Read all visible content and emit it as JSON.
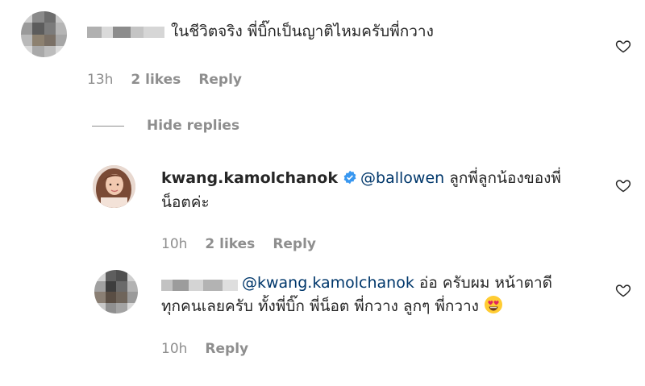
{
  "comments": [
    {
      "text": "ในชีวิตจริง พี่บิ๊กเป็นญาติไหมครับพี่กวาง",
      "time": "13h",
      "likes": "2 likes",
      "reply_label": "Reply"
    }
  ],
  "hide_replies_label": "Hide replies",
  "replies": [
    {
      "username": "kwang.kamolchanok",
      "mention": "@ballowen",
      "text_line1": "ลูกพี่ลูกน้องของพี่",
      "text_line2": "น็อตค่ะ",
      "time": "10h",
      "likes": "2 likes",
      "reply_label": "Reply"
    },
    {
      "mention": "@kwang.kamolchanok",
      "text_line1": "อ่อ ครับผม หน้าตาดี",
      "text_line2": "ทุกคนเลยครับ ทั้งพี่บิ๊ก พี่น็อต พี่กวาง ลูกๆ พี่กวาง",
      "time": "10h",
      "reply_label": "Reply"
    }
  ],
  "icons": {
    "like": "heart-icon",
    "verified": "verified-badge-icon",
    "emoji": "heart-eyes-emoji"
  },
  "colors": {
    "text": "#262626",
    "muted": "#8e8e8e",
    "mention": "#00376b",
    "verified": "#3897f0"
  }
}
